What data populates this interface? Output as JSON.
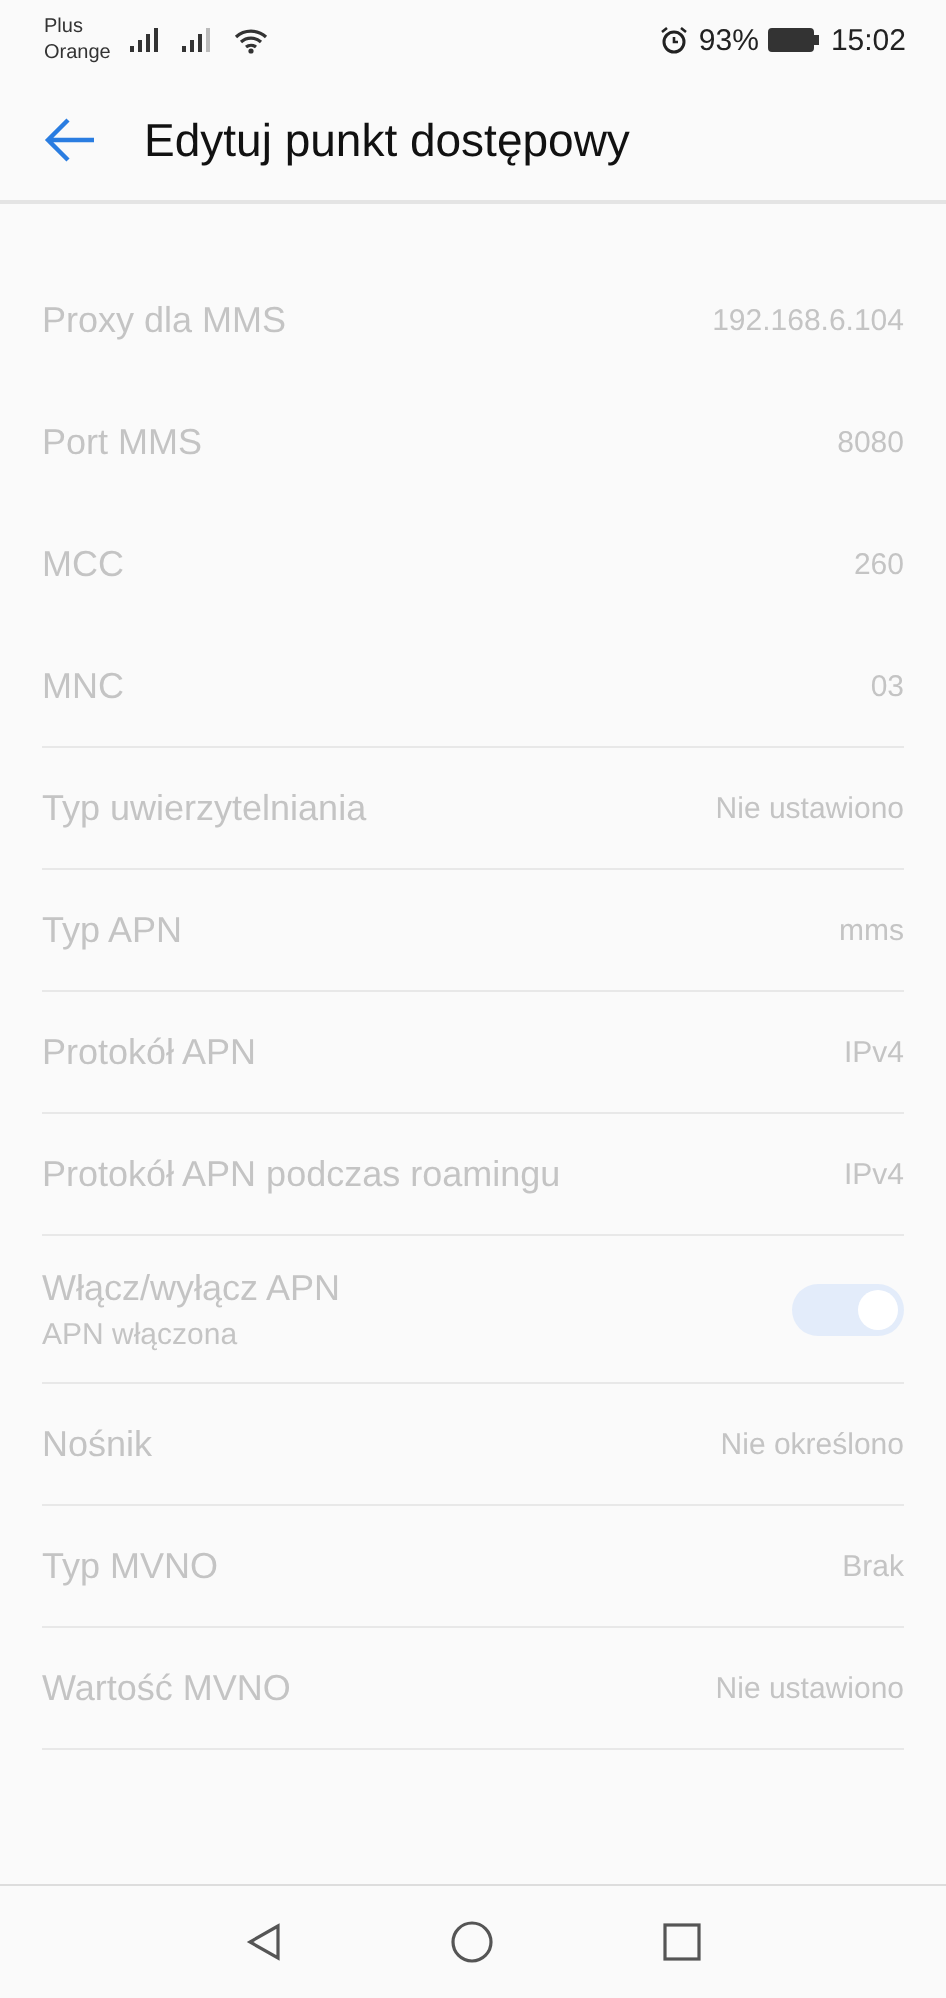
{
  "status_bar": {
    "carriers": [
      "Plus",
      "Orange"
    ],
    "battery": "93%",
    "time": "15:02"
  },
  "header": {
    "title": "Edytuj punkt dostępowy"
  },
  "settings": [
    {
      "kind": "value",
      "label": "Proxy dla MMS",
      "value": "192.168.6.104",
      "disabled": true
    },
    {
      "kind": "value",
      "label": "Port MMS",
      "value": "8080",
      "disabled": true
    },
    {
      "kind": "value",
      "label": "MCC",
      "value": "260",
      "disabled": true
    },
    {
      "kind": "value",
      "label": "MNC",
      "value": "03",
      "disabled": true
    },
    {
      "kind": "value",
      "label": "Typ uwierzytelniania",
      "value": "Nie ustawiono",
      "disabled": true
    },
    {
      "kind": "value",
      "label": "Typ APN",
      "value": "mms",
      "disabled": true
    },
    {
      "kind": "value",
      "label": "Protokół APN",
      "value": "IPv4",
      "disabled": true
    },
    {
      "kind": "value",
      "label": "Protokół APN podczas roamingu",
      "value": "IPv4",
      "disabled": true
    },
    {
      "kind": "toggle",
      "label": "Włącz/wyłącz APN",
      "summary": "APN włączona",
      "on": true,
      "disabled": true
    },
    {
      "kind": "value",
      "label": "Nośnik",
      "value": "Nie określono",
      "disabled": true
    },
    {
      "kind": "value",
      "label": "Typ MVNO",
      "value": "Brak",
      "disabled": true
    },
    {
      "kind": "value",
      "label": "Wartość MVNO",
      "value": "Nie ustawiono",
      "disabled": true
    }
  ]
}
